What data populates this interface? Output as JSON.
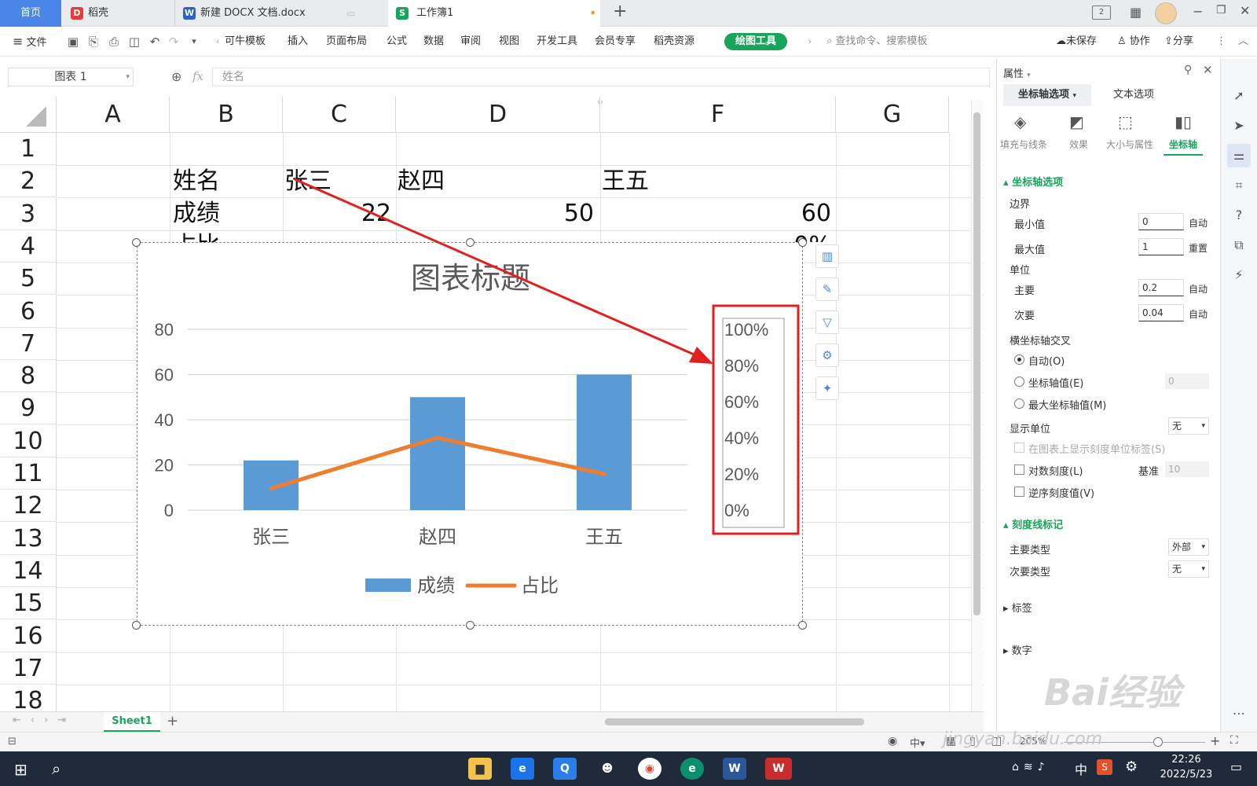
{
  "tabs": {
    "home": "首页",
    "daoke": "稻壳",
    "doc": "新建 DOCX 文档.docx",
    "workbook": "工作簿1"
  },
  "menu": {
    "file": "文件",
    "items": [
      "可牛模板",
      "插入",
      "页面布局",
      "公式",
      "数据",
      "审阅",
      "视图",
      "开发工具",
      "会员专享",
      "稻壳资源"
    ],
    "draw_tool": "绘图工具",
    "search_placeholder": "查找命令、搜索模板",
    "unsaved": "未保存",
    "collab": "协作",
    "share": "分享"
  },
  "formula_bar": {
    "name_box": "图表 1",
    "fx": "fx",
    "content": "姓名"
  },
  "grid": {
    "columns": [
      "A",
      "B",
      "C",
      "D",
      "F",
      "G"
    ],
    "rows": [
      "1",
      "2",
      "3",
      "4",
      "5",
      "6",
      "7",
      "8",
      "9",
      "10",
      "11",
      "12",
      "13",
      "14",
      "15",
      "16",
      "17",
      "18"
    ],
    "cells": {
      "b2": "姓名",
      "c2": "张三",
      "d2": "赵四",
      "f2": "王五",
      "b3": "成绩",
      "c3": "22",
      "d3": "50",
      "f3": "60",
      "b4_partial": "占比",
      "f4_partial": "0%"
    }
  },
  "chart_data": {
    "type": "bar",
    "title": "图表标题",
    "categories": [
      "张三",
      "赵四",
      "王五"
    ],
    "series": [
      {
        "name": "成绩",
        "type": "bar",
        "values": [
          22,
          50,
          60
        ],
        "color": "#5b9bd5"
      },
      {
        "name": "占比",
        "type": "line",
        "values": [
          0.12,
          0.4,
          0.2
        ],
        "color": "#ed7d31",
        "axis": "secondary"
      }
    ],
    "y_ticks": [
      "80",
      "60",
      "40",
      "20",
      "0"
    ],
    "ylim": [
      0,
      80
    ],
    "y2_ticks": [
      "100%",
      "80%",
      "60%",
      "40%",
      "20%",
      "0%"
    ],
    "y2lim": [
      0,
      1
    ],
    "grid": true,
    "legend_placement": "bottom"
  },
  "sheet": {
    "tab_name": "Sheet1"
  },
  "status": {
    "zoom": "205%"
  },
  "panel": {
    "header": "属性",
    "tab_axis_options": "坐标轴选项",
    "tab_text_options": "文本选项",
    "subtabs": [
      "填充与线条",
      "效果",
      "大小与属性",
      "坐标轴"
    ],
    "section_axis": "坐标轴选项",
    "bounds": "边界",
    "min_label": "最小值",
    "min_value": "0",
    "min_btn": "自动",
    "max_label": "最大值",
    "max_value": "1",
    "max_btn": "重置",
    "unit": "单位",
    "major_label": "主要",
    "major_value": "0.2",
    "major_btn": "自动",
    "minor_label": "次要",
    "minor_value": "0.04",
    "minor_btn": "自动",
    "cross": "横坐标轴交叉",
    "radio_auto": "自动(O)",
    "radio_value": "坐标轴值(E)",
    "radio_value_input": "0",
    "radio_max": "最大坐标轴值(M)",
    "display_unit": "显示单位",
    "display_unit_value": "无",
    "show_unit_label": "在图表上显示刻度单位标签(S)",
    "log_scale": "对数刻度(L)",
    "base_label": "基准",
    "base_value": "10",
    "reverse": "逆序刻度值(V)",
    "section_ticks": "刻度线标记",
    "major_type": "主要类型",
    "major_type_value": "外部",
    "minor_type": "次要类型",
    "minor_type_value": "无",
    "labels": "标签",
    "number": "数字"
  },
  "taskbar": {
    "time": "22:26",
    "date": "2022/5/23",
    "ime": "中"
  },
  "watermark": {
    "brand": "Bai经验",
    "url": "jingyan.baidu.com"
  },
  "colors": {
    "accent": "#1aa35a",
    "home_tab": "#4a86e8",
    "highlight": "#e32020"
  }
}
